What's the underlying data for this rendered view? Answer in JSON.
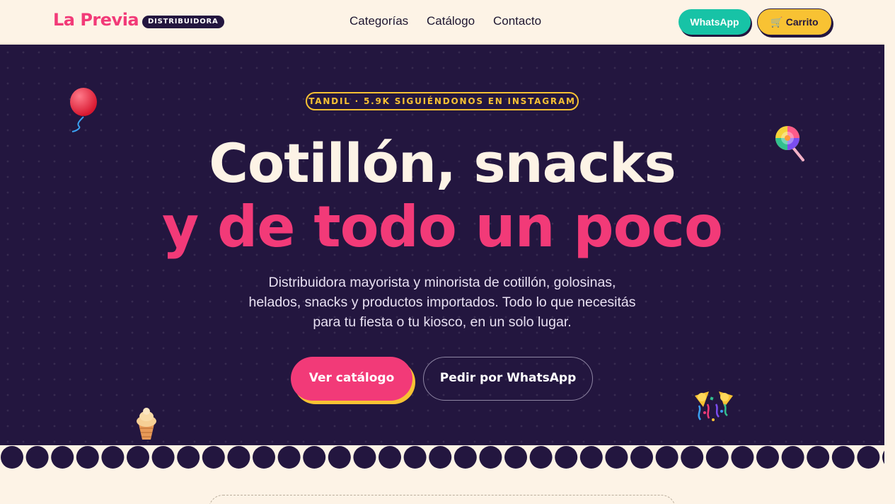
{
  "header": {
    "logo": "La Previa",
    "logo_badge": "DISTRIBUIDORA",
    "nav": [
      "Categorías",
      "Catálogo",
      "Contacto"
    ],
    "whatsapp_label": "WhatsApp",
    "cart_label": "🛒 Carrito"
  },
  "hero": {
    "tag": "TANDIL · 5.9K SIGUIÉNDONOS EN INSTAGRAM",
    "title_line1": "Cotillón, snacks",
    "title_line2": "y de todo un poco",
    "lead": "Distribuidora mayorista y minorista de cotillón, golosinas, helados, snacks y productos importados. Todo lo que necesitás para tu fiesta o tu kiosco, en un solo lugar.",
    "cta_primary": "Ver catálogo",
    "cta_secondary": "Pedir por WhatsApp"
  },
  "decorations": [
    "balloon-icon",
    "lollipop-icon",
    "ice-cream-icon",
    "party-popper-icon"
  ],
  "colors": {
    "cream": "#fdf3e6",
    "navy": "#23163f",
    "pink": "#f23a78",
    "yellow": "#f8c233",
    "teal": "#17c3a6"
  }
}
